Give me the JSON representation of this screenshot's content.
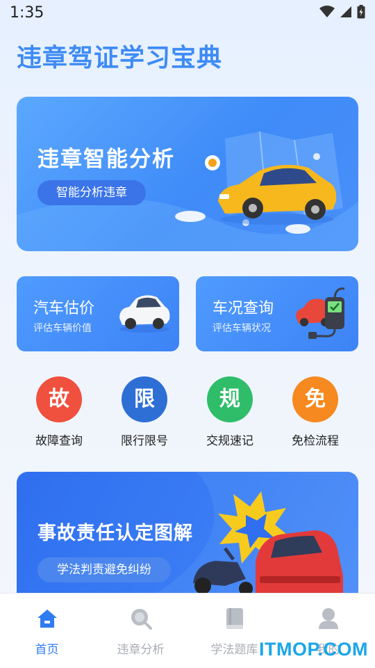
{
  "status_bar": {
    "time": "1:35"
  },
  "app": {
    "title": "违章驾证学习宝典"
  },
  "banner": {
    "title": "违章智能分析",
    "button_label": "智能分析违章"
  },
  "cards": [
    {
      "title": "汽车估价",
      "subtitle": "评估车辆价值"
    },
    {
      "title": "车况查询",
      "subtitle": "评估车辆状况"
    }
  ],
  "quick_actions": [
    {
      "glyph": "故",
      "label": "故障查询",
      "color": "#f0503e"
    },
    {
      "glyph": "限",
      "label": "限行限号",
      "color": "#2e6fd6"
    },
    {
      "glyph": "规",
      "label": "交规速记",
      "color": "#2fbd6a"
    },
    {
      "glyph": "免",
      "label": "免检流程",
      "color": "#f6891f"
    }
  ],
  "banner2": {
    "title": "事故责任认定图解",
    "button_label": "学法判责避免纠纷"
  },
  "tabs": [
    {
      "label": "首页",
      "icon": "home-icon",
      "active": true
    },
    {
      "label": "违章分析",
      "icon": "search-icon",
      "active": false
    },
    {
      "label": "学法题库",
      "icon": "book-icon",
      "active": false
    },
    {
      "label": "我的",
      "icon": "user-icon",
      "active": false
    }
  ],
  "watermark": "ITMOP.COM"
}
